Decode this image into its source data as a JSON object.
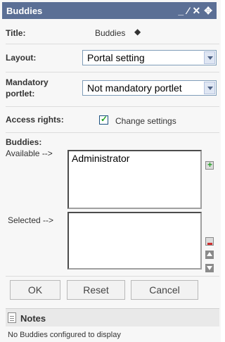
{
  "titlebar": {
    "title": "Buddies",
    "controls": [
      "minimize-icon",
      "edit-icon",
      "close-icon",
      "move-icon"
    ]
  },
  "form": {
    "title_label": "Title:",
    "title_value": "Buddies",
    "layout_label": "Layout:",
    "layout_value": "Portal setting",
    "mandatory_label_line1": "Mandatory",
    "mandatory_label_line2": "portlet:",
    "mandatory_value": "Not mandatory portlet",
    "access_label": "Access rights:",
    "access_checked": true,
    "access_option": "Change settings",
    "buddies_label": "Buddies:",
    "available_label": "Available -->",
    "available_items": [
      "Administrator"
    ],
    "selected_label": "Selected -->",
    "selected_items": []
  },
  "buttons": {
    "ok": "OK",
    "reset": "Reset",
    "cancel": "Cancel"
  },
  "notes": {
    "title": "Notes",
    "text": "No Buddies configured to display"
  }
}
